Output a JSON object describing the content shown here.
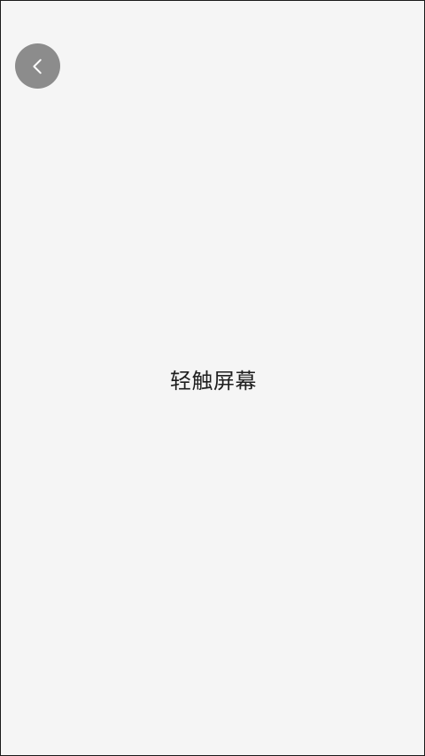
{
  "screen": {
    "background_color": "#f5f5f5",
    "back_button": {
      "icon": "chevron-left-icon",
      "background_color": "#8c8c8c",
      "icon_color": "#ffffff"
    },
    "prompt_text": "轻触屏幕"
  }
}
